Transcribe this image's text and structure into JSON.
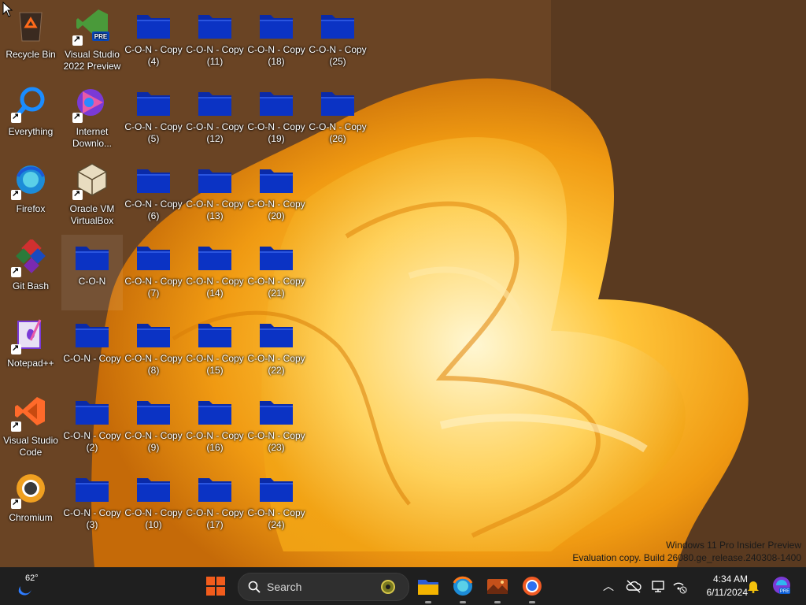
{
  "desktop": {
    "icons": [
      {
        "label": "Recycle Bin",
        "type": "recycle",
        "col": 0,
        "row": 0
      },
      {
        "label": "Everything",
        "type": "everything",
        "col": 0,
        "row": 1
      },
      {
        "label": "Firefox",
        "type": "firefox",
        "col": 0,
        "row": 2
      },
      {
        "label": "Git Bash",
        "type": "gitbash",
        "col": 0,
        "row": 3
      },
      {
        "label": "Notepad++",
        "type": "notepadpp",
        "col": 0,
        "row": 4
      },
      {
        "label": "Visual Studio Code",
        "type": "vscode",
        "col": 0,
        "row": 5
      },
      {
        "label": "Chromium",
        "type": "chromium",
        "col": 0,
        "row": 6
      },
      {
        "label": "Visual Studio 2022 Preview",
        "type": "vspreview",
        "col": 1,
        "row": 0
      },
      {
        "label": "Internet Downlo...",
        "type": "idm",
        "col": 1,
        "row": 1
      },
      {
        "label": "Oracle VM VirtualBox",
        "type": "virtualbox",
        "col": 1,
        "row": 2
      },
      {
        "label": "C-O-N",
        "type": "folder",
        "col": 1,
        "row": 3,
        "selected": true
      },
      {
        "label": "C-O-N - Copy",
        "type": "folder",
        "col": 1,
        "row": 4
      },
      {
        "label": "C-O-N - Copy (2)",
        "type": "folder",
        "col": 1,
        "row": 5
      },
      {
        "label": "C-O-N - Copy (3)",
        "type": "folder",
        "col": 1,
        "row": 6
      },
      {
        "label": "C-O-N - Copy (4)",
        "type": "folder",
        "col": 2,
        "row": 0
      },
      {
        "label": "C-O-N - Copy (5)",
        "type": "folder",
        "col": 2,
        "row": 1
      },
      {
        "label": "C-O-N - Copy (6)",
        "type": "folder",
        "col": 2,
        "row": 2
      },
      {
        "label": "C-O-N - Copy (7)",
        "type": "folder",
        "col": 2,
        "row": 3
      },
      {
        "label": "C-O-N - Copy (8)",
        "type": "folder",
        "col": 2,
        "row": 4
      },
      {
        "label": "C-O-N - Copy (9)",
        "type": "folder",
        "col": 2,
        "row": 5
      },
      {
        "label": "C-O-N - Copy (10)",
        "type": "folder",
        "col": 2,
        "row": 6
      },
      {
        "label": "C-O-N - Copy (11)",
        "type": "folder",
        "col": 3,
        "row": 0
      },
      {
        "label": "C-O-N - Copy (12)",
        "type": "folder",
        "col": 3,
        "row": 1
      },
      {
        "label": "C-O-N - Copy (13)",
        "type": "folder",
        "col": 3,
        "row": 2
      },
      {
        "label": "C-O-N - Copy (14)",
        "type": "folder",
        "col": 3,
        "row": 3
      },
      {
        "label": "C-O-N - Copy (15)",
        "type": "folder",
        "col": 3,
        "row": 4
      },
      {
        "label": "C-O-N - Copy (16)",
        "type": "folder",
        "col": 3,
        "row": 5
      },
      {
        "label": "C-O-N - Copy (17)",
        "type": "folder",
        "col": 3,
        "row": 6
      },
      {
        "label": "C-O-N - Copy (18)",
        "type": "folder",
        "col": 4,
        "row": 0
      },
      {
        "label": "C-O-N - Copy (19)",
        "type": "folder",
        "col": 4,
        "row": 1
      },
      {
        "label": "C-O-N - Copy (20)",
        "type": "folder",
        "col": 4,
        "row": 2
      },
      {
        "label": "C-O-N - Copy (21)",
        "type": "folder",
        "col": 4,
        "row": 3
      },
      {
        "label": "C-O-N - Copy (22)",
        "type": "folder",
        "col": 4,
        "row": 4
      },
      {
        "label": "C-O-N - Copy (23)",
        "type": "folder",
        "col": 4,
        "row": 5
      },
      {
        "label": "C-O-N - Copy (24)",
        "type": "folder",
        "col": 4,
        "row": 6
      },
      {
        "label": "C-O-N - Copy (25)",
        "type": "folder",
        "col": 5,
        "row": 0
      },
      {
        "label": "C-O-N - Copy (26)",
        "type": "folder",
        "col": 5,
        "row": 1
      }
    ],
    "watermark": {
      "line1": "Windows 11 Pro Insider Preview",
      "line2": "Evaluation copy. Build 26080.ge_release.240308-1400"
    }
  },
  "taskbar": {
    "weather_temp": "62°",
    "search_placeholder": "Search",
    "apps": [
      {
        "name": "File Explorer",
        "icon": "folder-icon"
      },
      {
        "name": "Firefox",
        "icon": "firefox-icon"
      },
      {
        "name": "Photos",
        "icon": "photos-icon"
      },
      {
        "name": "Chromium",
        "icon": "chromium-icon"
      }
    ],
    "tray": {
      "time": "4:34 AM",
      "date": "6/11/2024"
    }
  },
  "colors": {
    "folder": "#0b2db8",
    "taskbar": "#1f1f1f",
    "accent": "#0067c0"
  }
}
